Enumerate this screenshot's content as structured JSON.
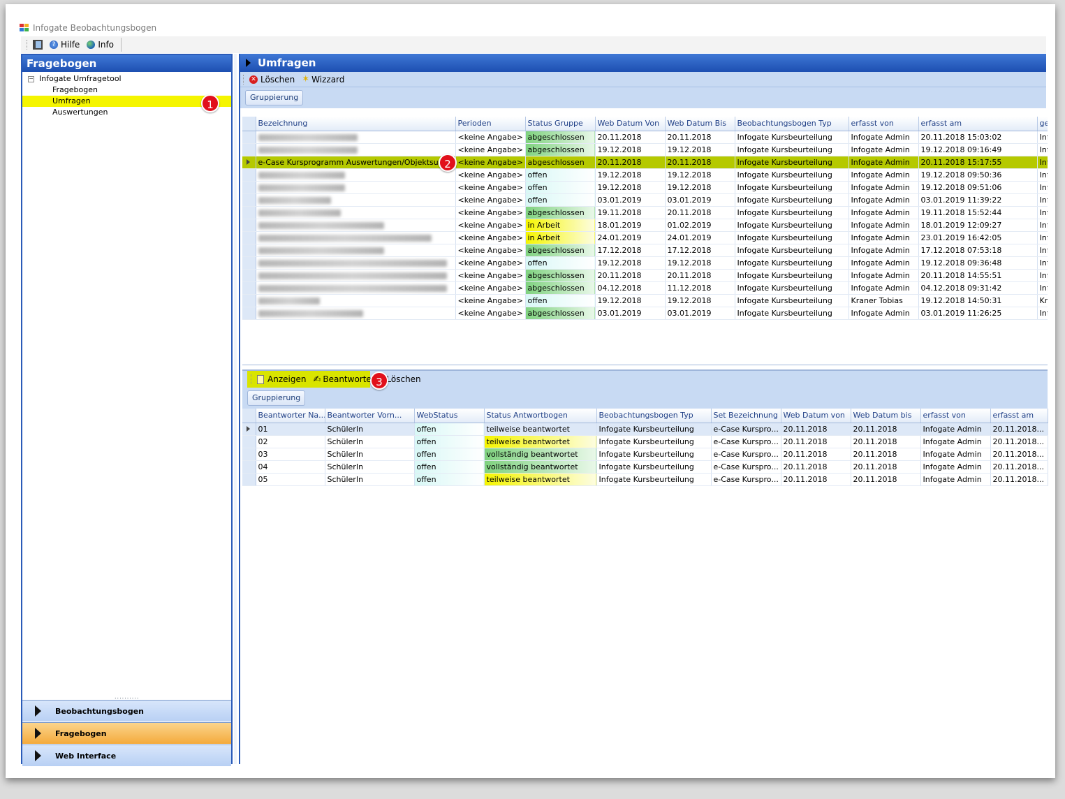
{
  "window": {
    "title": "Infogate Beobachtungsbogen"
  },
  "main_toolbar": {
    "help_label": "Hilfe",
    "info_label": "Info"
  },
  "left": {
    "header": "Fragebogen",
    "tree": {
      "root": "Infogate Umfragetool",
      "toggle": "−",
      "children": [
        "Fragebogen",
        "Umfragen",
        "Auswertungen"
      ],
      "selected": "Umfragen"
    },
    "splitter": "..........",
    "nav": [
      {
        "label": "Beobachtungsbogen",
        "active": false
      },
      {
        "label": "Fragebogen",
        "active": true
      },
      {
        "label": "Web Interface",
        "active": false
      }
    ]
  },
  "right": {
    "header": "Umfragen",
    "toolbar": {
      "delete_label": "Löschen",
      "wizard_label": "Wizzard"
    },
    "grouping_label": "Gruppierung",
    "grid": {
      "columns": [
        "Bezeichnung",
        "Perioden",
        "Status Gruppe",
        "Web Datum Von",
        "Web Datum Bis",
        "Beobachtungsbogen Typ",
        "erfasst von",
        "erfasst am",
        "ge"
      ],
      "rows": [
        {
          "name": "",
          "period": "<keine Angabe>",
          "status": "abgeschlossen",
          "von": "20.11.2018",
          "bis": "20.11.2018",
          "typ": "Infogate Kursbeurteilung",
          "erfasst_von": "Infogate Admin",
          "erfasst_am": "20.11.2018 15:03:02",
          "ge": "Inf"
        },
        {
          "name": "",
          "period": "<keine Angabe>",
          "status": "abgeschlossen",
          "von": "19.12.2018",
          "bis": "19.12.2018",
          "typ": "Infogate Kursbeurteilung",
          "erfasst_von": "Infogate Admin",
          "erfasst_am": "19.12.2018 09:16:49",
          "ge": "Inf"
        },
        {
          "name": "e-Case Kursprogramm Auswertungen/Objektsuche",
          "period": "<keine Angabe>",
          "status": "abgeschlossen",
          "von": "20.11.2018",
          "bis": "20.11.2018",
          "typ": "Infogate Kursbeurteilung",
          "erfasst_von": "Infogate Admin",
          "erfasst_am": "20.11.2018 15:17:55",
          "ge": "Inf"
        },
        {
          "name": "",
          "period": "<keine Angabe>",
          "status": "offen",
          "von": "19.12.2018",
          "bis": "19.12.2018",
          "typ": "Infogate Kursbeurteilung",
          "erfasst_von": "Infogate Admin",
          "erfasst_am": "19.12.2018 09:50:36",
          "ge": "Inf"
        },
        {
          "name": "",
          "period": "<keine Angabe>",
          "status": "offen",
          "von": "19.12.2018",
          "bis": "19.12.2018",
          "typ": "Infogate Kursbeurteilung",
          "erfasst_von": "Infogate Admin",
          "erfasst_am": "19.12.2018 09:51:06",
          "ge": "Inf"
        },
        {
          "name": "",
          "period": "<keine Angabe>",
          "status": "offen",
          "von": "03.01.2019",
          "bis": "03.01.2019",
          "typ": "Infogate Kursbeurteilung",
          "erfasst_von": "Infogate Admin",
          "erfasst_am": "03.01.2019 11:39:22",
          "ge": "Inf"
        },
        {
          "name": "",
          "period": "<keine Angabe>",
          "status": "abgeschlossen",
          "von": "19.11.2018",
          "bis": "20.11.2018",
          "typ": "Infogate Kursbeurteilung",
          "erfasst_von": "Infogate Admin",
          "erfasst_am": "19.11.2018 15:52:44",
          "ge": "Inf"
        },
        {
          "name": "",
          "period": "<keine Angabe>",
          "status": "in Arbeit",
          "von": "18.01.2019",
          "bis": "01.02.2019",
          "typ": "Infogate Kursbeurteilung",
          "erfasst_von": "Infogate Admin",
          "erfasst_am": "18.01.2019 12:09:27",
          "ge": "Inf"
        },
        {
          "name": "",
          "period": "<keine Angabe>",
          "status": "in Arbeit",
          "von": "24.01.2019",
          "bis": "24.01.2019",
          "typ": "Infogate Kursbeurteilung",
          "erfasst_von": "Infogate Admin",
          "erfasst_am": "23.01.2019 16:42:05",
          "ge": "Inf"
        },
        {
          "name": "",
          "period": "<keine Angabe>",
          "status": "abgeschlossen",
          "von": "17.12.2018",
          "bis": "17.12.2018",
          "typ": "Infogate Kursbeurteilung",
          "erfasst_von": "Infogate Admin",
          "erfasst_am": "17.12.2018 07:53:18",
          "ge": "Inf"
        },
        {
          "name": "",
          "period": "<keine Angabe>",
          "status": "offen",
          "von": "19.12.2018",
          "bis": "19.12.2018",
          "typ": "Infogate Kursbeurteilung",
          "erfasst_von": "Infogate Admin",
          "erfasst_am": "19.12.2018 09:36:48",
          "ge": "Inf"
        },
        {
          "name": "",
          "period": "<keine Angabe>",
          "status": "abgeschlossen",
          "von": "20.11.2018",
          "bis": "20.11.2018",
          "typ": "Infogate Kursbeurteilung",
          "erfasst_von": "Infogate Admin",
          "erfasst_am": "20.11.2018 14:55:51",
          "ge": "Inf"
        },
        {
          "name": "",
          "period": "<keine Angabe>",
          "status": "abgeschlossen",
          "von": "04.12.2018",
          "bis": "11.12.2018",
          "typ": "Infogate Kursbeurteilung",
          "erfasst_von": "Infogate Admin",
          "erfasst_am": "04.12.2018 09:31:42",
          "ge": "Inf"
        },
        {
          "name": "",
          "period": "<keine Angabe>",
          "status": "offen",
          "von": "19.12.2018",
          "bis": "19.12.2018",
          "typ": "Infogate Kursbeurteilung",
          "erfasst_von": "Kraner Tobias",
          "erfasst_am": "19.12.2018 14:50:31",
          "ge": "Kra"
        },
        {
          "name": "",
          "period": "<keine Angabe>",
          "status": "abgeschlossen",
          "von": "03.01.2019",
          "bis": "03.01.2019",
          "typ": "Infogate Kursbeurteilung",
          "erfasst_von": "Infogate Admin",
          "erfasst_am": "03.01.2019 11:26:25",
          "ge": "Inf"
        }
      ]
    },
    "lower_toolbar": {
      "show_label": "Anzeigen",
      "answer_label": "Beantworten",
      "delete_label": "Löschen"
    },
    "lower_grouping_label": "Gruppierung",
    "lower_grid": {
      "columns": [
        "Beantworter Na...",
        "Beantworter Vorn...",
        "WebStatus",
        "Status Antwortbogen",
        "Beobachtungsbogen Typ",
        "Set Bezeichnung",
        "Web Datum von",
        "Web Datum bis",
        "erfasst von",
        "erfasst am"
      ],
      "rows": [
        {
          "nr": "01",
          "vorname": "SchülerIn",
          "webstatus": "offen",
          "status": "teilweise beantwortet",
          "typ": "Infogate Kursbeurteilung",
          "set": "e-Case Kurspro...",
          "von": "20.11.2018",
          "bis": "20.11.2018",
          "erfasst_von": "Infogate Admin",
          "erfasst_am": "20.11.2018..."
        },
        {
          "nr": "02",
          "vorname": "SchülerIn",
          "webstatus": "offen",
          "status": "teilweise beantwortet",
          "typ": "Infogate Kursbeurteilung",
          "set": "e-Case Kurspro...",
          "von": "20.11.2018",
          "bis": "20.11.2018",
          "erfasst_von": "Infogate Admin",
          "erfasst_am": "20.11.2018..."
        },
        {
          "nr": "03",
          "vorname": "SchülerIn",
          "webstatus": "offen",
          "status": "vollständig beantwortet",
          "typ": "Infogate Kursbeurteilung",
          "set": "e-Case Kurspro...",
          "von": "20.11.2018",
          "bis": "20.11.2018",
          "erfasst_von": "Infogate Admin",
          "erfasst_am": "20.11.2018..."
        },
        {
          "nr": "04",
          "vorname": "SchülerIn",
          "webstatus": "offen",
          "status": "vollständig beantwortet",
          "typ": "Infogate Kursbeurteilung",
          "set": "e-Case Kurspro...",
          "von": "20.11.2018",
          "bis": "20.11.2018",
          "erfasst_von": "Infogate Admin",
          "erfasst_am": "20.11.2018..."
        },
        {
          "nr": "05",
          "vorname": "SchülerIn",
          "webstatus": "offen",
          "status": "teilweise beantwortet",
          "typ": "Infogate Kursbeurteilung",
          "set": "e-Case Kurspro...",
          "von": "20.11.2018",
          "bis": "20.11.2018",
          "erfasst_von": "Infogate Admin",
          "erfasst_am": "20.11.2018..."
        }
      ]
    }
  },
  "callouts": [
    "1",
    "2",
    "3"
  ],
  "colors": {
    "accent_blue": "#1d4fb1",
    "highlight_yellow": "#f5f500",
    "selected_row": "#b5c900",
    "status_green": "#7fd27f",
    "badge_red": "#e1101b",
    "nav_active": "#f4aa3c"
  }
}
